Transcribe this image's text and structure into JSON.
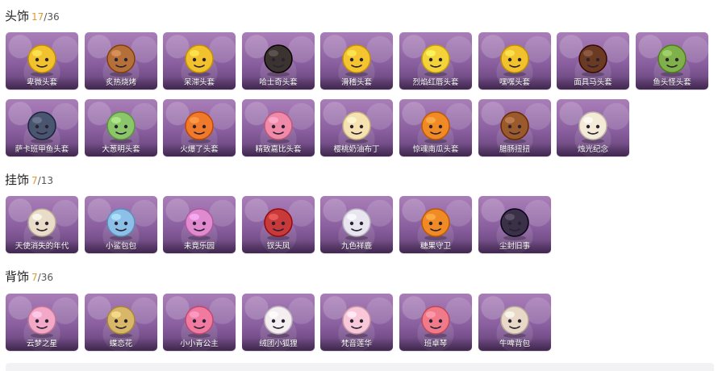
{
  "sections": [
    {
      "title": "头饰",
      "have": "17",
      "total": "/36",
      "items": [
        {
          "label": "卑微头套",
          "icon": "shy-emoji-head-icon",
          "color": "#f2c12e"
        },
        {
          "label": "炙热烧烤",
          "icon": "grill-head-icon",
          "color": "#b5703a"
        },
        {
          "label": "呆滞头套",
          "icon": "dazed-emoji-head-icon",
          "color": "#f2c12e"
        },
        {
          "label": "哈士奇头套",
          "icon": "husky-head-icon",
          "color": "#3a3330"
        },
        {
          "label": "滑稽头套",
          "icon": "funny-emoji-head-icon",
          "color": "#f5c431"
        },
        {
          "label": "烈焰红唇头套",
          "icon": "pikachu-head-icon",
          "color": "#f4d23a"
        },
        {
          "label": "嘿嘿头套",
          "icon": "grin-emoji-head-icon",
          "color": "#f2c12e"
        },
        {
          "label": "面具马头套",
          "icon": "horse-head-icon",
          "color": "#6b3a22"
        },
        {
          "label": "鱼头怪头套",
          "icon": "fish-head-icon",
          "color": "#7fb04a"
        },
        {
          "label": "萨卡班甲鱼头套",
          "icon": "sacabambaspis-head-icon",
          "color": "#4a5570"
        },
        {
          "label": "大葱明头套",
          "icon": "scallion-head-icon",
          "color": "#8cc66a"
        },
        {
          "label": "火爆了头套",
          "icon": "flame-head-icon",
          "color": "#f07a2a"
        },
        {
          "label": "精致嘉比头套",
          "icon": "pink-pig-head-icon",
          "color": "#f08aa8"
        },
        {
          "label": "樱桃奶油布丁",
          "icon": "pudding-head-icon",
          "color": "#f5e2b0"
        },
        {
          "label": "惊魂南瓜头套",
          "icon": "pumpkin-head-icon",
          "color": "#f08a25"
        },
        {
          "label": "腊肠扭扭",
          "icon": "sausage-dog-head-icon",
          "color": "#9a5a2c"
        },
        {
          "label": "烛光纪念",
          "icon": "candle-head-icon",
          "color": "#f3ead8"
        }
      ]
    },
    {
      "title": "挂饰",
      "have": "7",
      "total": "/13",
      "items": [
        {
          "label": "天使消失的年代",
          "icon": "angel-pendant-icon",
          "color": "#e9dcc8"
        },
        {
          "label": "小鲨包包",
          "icon": "shark-bag-pendant-icon",
          "color": "#8cc0e8"
        },
        {
          "label": "未竟乐园",
          "icon": "carnival-doll-pendant-icon",
          "color": "#e08ad0"
        },
        {
          "label": "钗头凤",
          "icon": "phoenix-crown-pendant-icon",
          "color": "#c83a3a"
        },
        {
          "label": "九色祥鹿",
          "icon": "nine-color-deer-pendant-icon",
          "color": "#e8e4f0"
        },
        {
          "label": "糖果守卫",
          "icon": "candy-guard-pendant-icon",
          "color": "#f08a25"
        },
        {
          "label": "尘封旧事",
          "icon": "vintage-doll-pendant-icon",
          "color": "#3a3048"
        }
      ]
    },
    {
      "title": "背饰",
      "have": "7",
      "total": "/36",
      "items": [
        {
          "label": "云梦之星",
          "icon": "unicorn-back-icon",
          "color": "#f4a8c8"
        },
        {
          "label": "蝶恋花",
          "icon": "butterfly-flower-back-icon",
          "color": "#d8b868"
        },
        {
          "label": "小小青公主",
          "icon": "little-princess-back-icon",
          "color": "#f07aa0"
        },
        {
          "label": "绒团小狐狸",
          "icon": "fluffy-fox-back-icon",
          "color": "#f4eef0"
        },
        {
          "label": "梵音莲华",
          "icon": "lotus-back-icon",
          "color": "#f8c8d8"
        },
        {
          "label": "班卓琴",
          "icon": "banjo-pig-back-icon",
          "color": "#f07a8a"
        },
        {
          "label": "牛啤背包",
          "icon": "cow-beer-back-icon",
          "color": "#e8d8c8"
        }
      ]
    }
  ]
}
